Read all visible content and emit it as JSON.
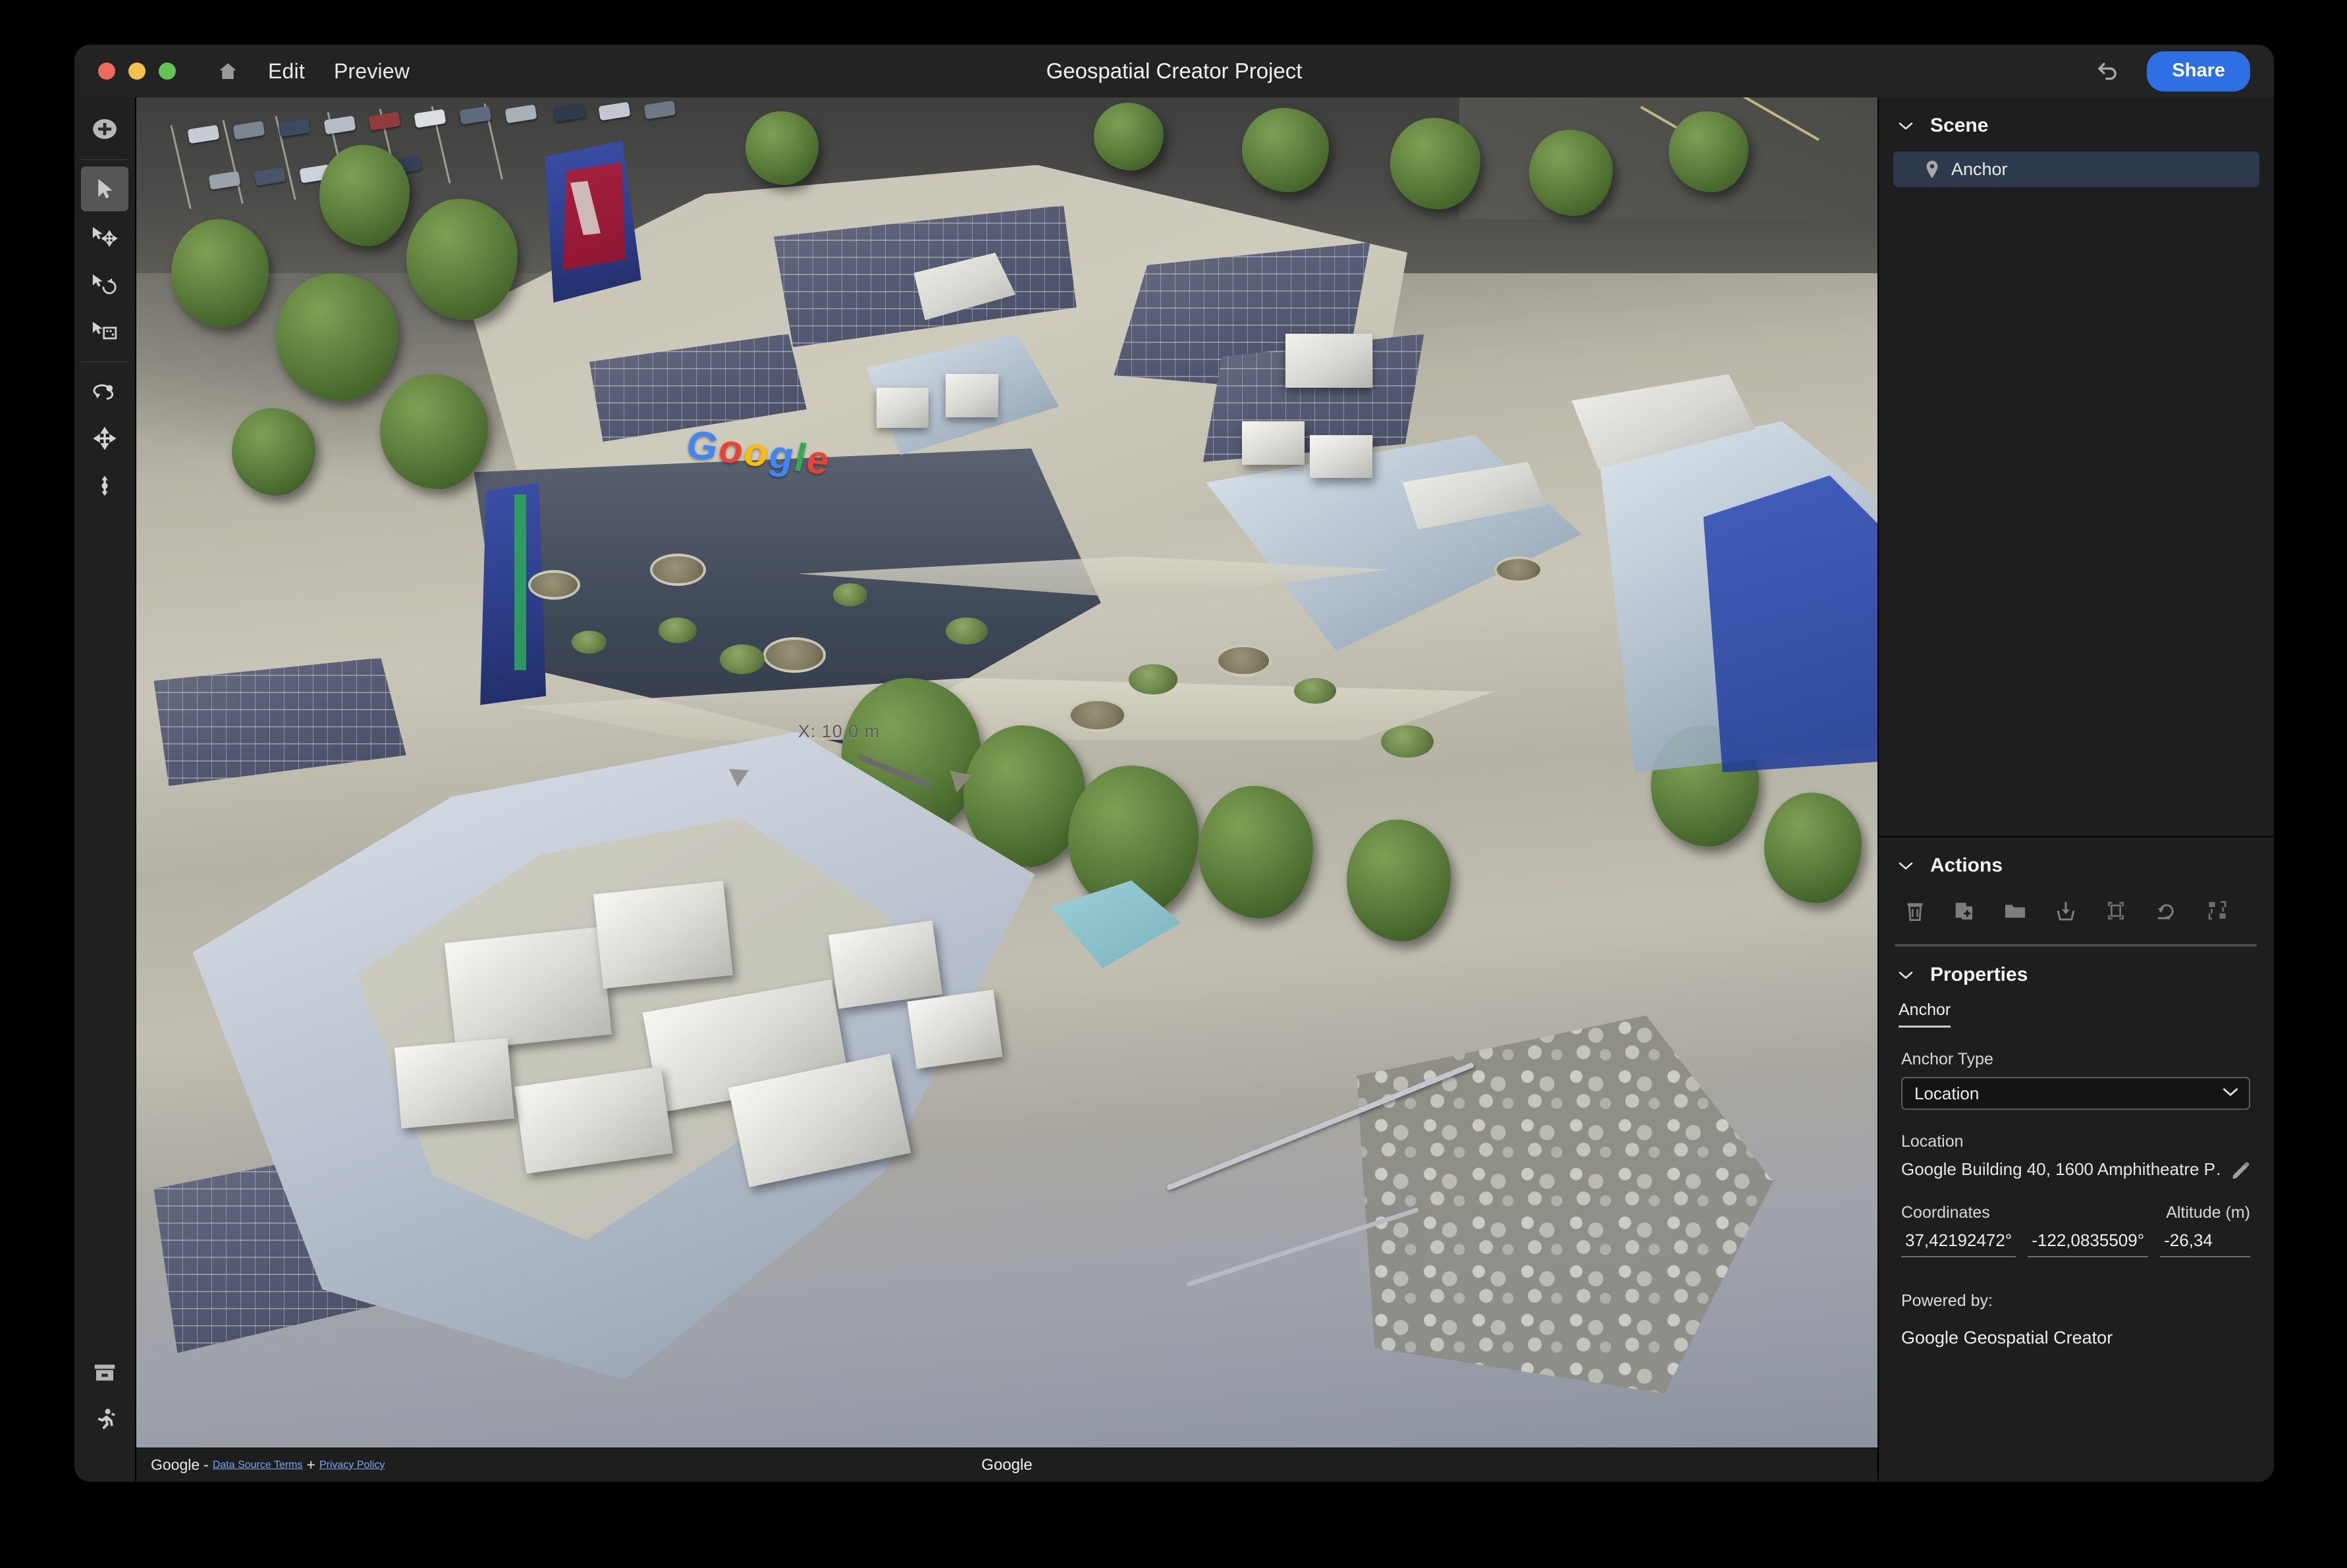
{
  "window": {
    "title": "Geospatial Creator Project",
    "traffic_lights": [
      "close",
      "minimize",
      "maximize"
    ],
    "menu": [
      {
        "name": "home-icon",
        "label": ""
      },
      {
        "name": "edit",
        "label": "Edit"
      },
      {
        "name": "preview",
        "label": "Preview"
      }
    ],
    "undo_icon": "undo-icon",
    "share_label": "Share"
  },
  "toolbar": {
    "tools": [
      {
        "name": "add-object-tool",
        "icon": "plus-circle-icon",
        "active": false
      },
      {
        "name": "select-tool",
        "icon": "cursor-arrow-icon",
        "active": true
      },
      {
        "name": "move-tool",
        "icon": "cursor-move-icon",
        "active": false
      },
      {
        "name": "rotate-tool",
        "icon": "cursor-rotate-icon",
        "active": false
      },
      {
        "name": "scale-tool",
        "icon": "cursor-scale-icon",
        "active": false
      },
      {
        "name": "orbit-tool",
        "icon": "orbit-icon",
        "active": false
      },
      {
        "name": "pan-tool",
        "icon": "pan-arrows-icon",
        "active": false
      },
      {
        "name": "zoom-elevation-tool",
        "icon": "vertical-arrows-icon",
        "active": false
      }
    ],
    "bottom_tools": [
      {
        "name": "assets-tool",
        "icon": "archive-box-icon"
      },
      {
        "name": "walk-mode-tool",
        "icon": "running-person-icon"
      }
    ]
  },
  "viewport": {
    "gizmo_label": "X: 10,0 m",
    "building_logo": "Google",
    "footer": {
      "attribution": "Google",
      "separator": "-",
      "data_source_terms": "Data Source Terms",
      "plus": "+",
      "privacy_policy": "Privacy Policy",
      "center_watermark": "Google"
    }
  },
  "panels": {
    "scene": {
      "title": "Scene",
      "expanded": true,
      "items": [
        {
          "icon": "map-pin-icon",
          "label": "Anchor",
          "selected": true
        }
      ]
    },
    "actions": {
      "title": "Actions",
      "expanded": true,
      "buttons": [
        {
          "name": "delete-action",
          "icon": "trash-icon"
        },
        {
          "name": "duplicate-action",
          "icon": "duplicate-icon"
        },
        {
          "name": "group-action",
          "icon": "folder-icon"
        },
        {
          "name": "import-action",
          "icon": "import-icon"
        },
        {
          "name": "frame-action",
          "icon": "frame-icon"
        },
        {
          "name": "reset-action",
          "icon": "undo-arrow-icon"
        },
        {
          "name": "replace-action",
          "icon": "swap-icon"
        }
      ]
    },
    "properties": {
      "title": "Properties",
      "expanded": true,
      "tab": "Anchor",
      "anchor_type_label": "Anchor Type",
      "anchor_type_value": "Location",
      "location_label": "Location",
      "location_value": "Google Building 40, 1600 Amphitheatre P…",
      "coordinates_label": "Coordinates",
      "altitude_label": "Altitude (m)",
      "latitude": "37,42192472°",
      "longitude": "-122,0835509°",
      "altitude": "-26,34",
      "powered_by_label": "Powered by:",
      "powered_by_value": "Google Geospatial Creator"
    }
  },
  "colors": {
    "accent_blue": "#2f6fe4",
    "panel_bg": "#1e1e1e",
    "toolbar_bg": "#202020",
    "titlebar_bg": "#232323",
    "selection_bg": "#2d3a4d",
    "link_blue": "#7aa9f0"
  }
}
